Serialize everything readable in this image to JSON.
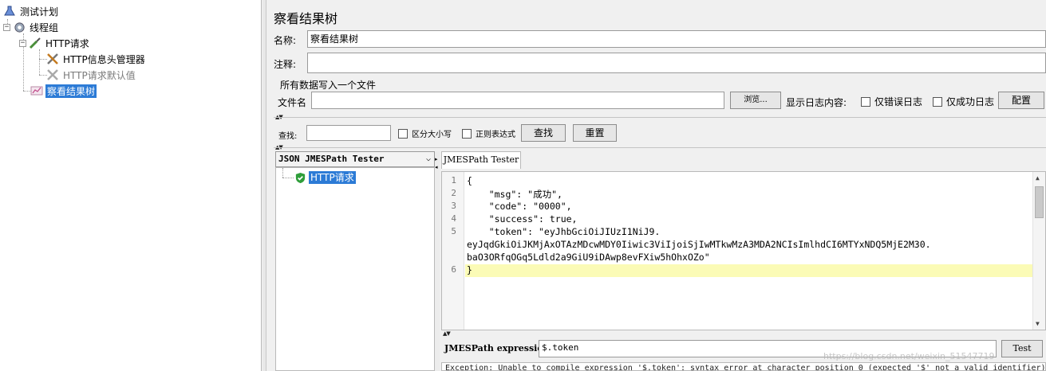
{
  "tree": {
    "items": [
      {
        "label": "测试计划"
      },
      {
        "label": "线程组"
      },
      {
        "label": "HTTP请求"
      },
      {
        "label": "HTTP信息头管理器"
      },
      {
        "label": "HTTP请求默认值"
      },
      {
        "label": "察看结果树"
      }
    ]
  },
  "panel": {
    "title": "察看结果树",
    "name_label": "名称:",
    "name_value": "察看结果树",
    "comment_label": "注释:",
    "comment_value": ""
  },
  "file_group": {
    "title": "所有数据写入一个文件",
    "filename_label": "文件名",
    "filename_value": "",
    "browse_label": "浏览...",
    "log_display_label": "显示日志内容:",
    "errors_only_label": "仅错误日志",
    "success_only_label": "仅成功日志",
    "configure_label": "配置"
  },
  "search": {
    "label": "查找:",
    "value": "",
    "case_sensitive_label": "区分大小写",
    "regex_label": "正则表达式",
    "find_label": "查找",
    "reset_label": "重置"
  },
  "renderer": {
    "selected": "JSON JMESPath Tester",
    "chevron": "⌵"
  },
  "results": {
    "items": [
      {
        "label": "HTTP请求",
        "status": "success"
      }
    ]
  },
  "tester": {
    "tab_label": "JMESPath Tester",
    "line_numbers": [
      "1",
      "2",
      "3",
      "4",
      "5",
      "6"
    ],
    "code_lines": [
      "{",
      "    \"msg\": \"成功\",",
      "    \"code\": \"0000\",",
      "    \"success\": true,",
      "    \"token\": \"eyJhbGciOiJIUzI1NiJ9.",
      "eyJqdGkiOiJKMjAxOTAzMDcwMDY0Iiwic3ViIjoiSjIwMTkwMzA3MDA2NCIsImlhdCI6MTYxNDQ5MjE2M30.",
      "baO3ORfqOGq5Ldld2a9GiU9iDAwp8evFXiw5hOhxOZo\"",
      "}"
    ],
    "expression_label": "JMESPath expression",
    "expression_value": "$.token",
    "test_label": "Test",
    "status_text": "Exception: Unable to compile expression '$.token': syntax error at character position 0 (expected '$' not a valid identifier)"
  },
  "watermark": "https://blog.csdn.net/weixin_51547719",
  "colors": {
    "selection": "#2c7bd6",
    "highlight_line": "#fbfbb6",
    "success_icon": "#2f9e3a"
  }
}
